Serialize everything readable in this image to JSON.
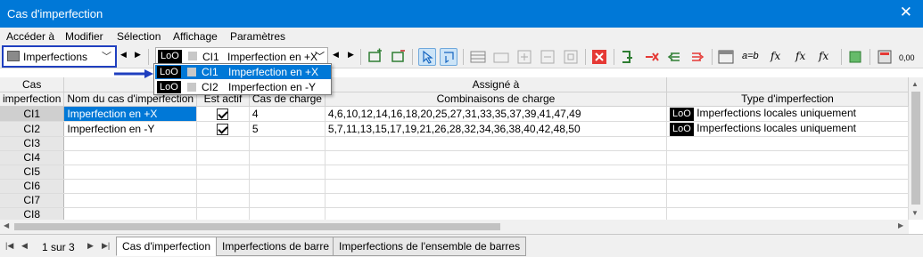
{
  "window": {
    "title": "Cas d'imperfection",
    "close_glyph": "✕"
  },
  "menu": [
    "Accéder à",
    "Modifier",
    "Sélection",
    "Affichage",
    "Paramètres"
  ],
  "toolbar": {
    "category_select": "Imperfections",
    "case_badge": "LoO",
    "case_code": "CI1",
    "case_name": "Imperfection en +X",
    "icons": [
      "insert-row-icon",
      "delete-row-icon",
      "select-icon",
      "pick-icon",
      "table-layout-icon",
      "table-add-icon",
      "table-insert-icon",
      "table-delete-icon",
      "table-copy-icon",
      "delete-icon",
      "load-icon",
      "remove-load-icon",
      "arrow-left-icon",
      "arrow-right-icon",
      "column-icon",
      "formula-ab-icon",
      "fx-icon",
      "fx-edit-icon",
      "fx-star-icon",
      "export-icon",
      "calculator-icon",
      "number-format-icon"
    ]
  },
  "dropdown": {
    "items": [
      {
        "badge": "LoO",
        "code": "CI1",
        "name": "Imperfection en +X",
        "active": true
      },
      {
        "badge": "LoO",
        "code": "CI2",
        "name": "Imperfection en -Y",
        "active": false
      }
    ]
  },
  "table": {
    "col_headers_top": [
      "Cas",
      "",
      "",
      "",
      "Assigné à",
      ""
    ],
    "col_headers_bottom": [
      "imperfection",
      "Nom du cas d'imperfection",
      "Est actif",
      "Cas de charge",
      "Combinaisons de charge",
      "Type d'imperfection"
    ],
    "rows": [
      {
        "id": "CI1",
        "name": "Imperfection en +X",
        "active": true,
        "load_case": "4",
        "combinations": "4,6,10,12,14,16,18,20,25,27,31,33,35,37,39,41,47,49",
        "type_badge": "LoO",
        "type": "Imperfections locales uniquement"
      },
      {
        "id": "CI2",
        "name": "Imperfection en -Y",
        "active": true,
        "load_case": "5",
        "combinations": "5,7,11,13,15,17,19,21,26,28,32,34,36,38,40,42,48,50",
        "type_badge": "LoO",
        "type": "Imperfections locales uniquement"
      },
      {
        "id": "CI3"
      },
      {
        "id": "CI4"
      },
      {
        "id": "CI5"
      },
      {
        "id": "CI6"
      },
      {
        "id": "CI7"
      },
      {
        "id": "CI8"
      }
    ]
  },
  "pager": {
    "info": "1 sur 3"
  },
  "tabs": [
    "Cas d'imperfection",
    "Imperfections de barre",
    "Imperfections de l'ensemble de barres"
  ],
  "colors": {
    "accent": "#0078d7",
    "callout": "#1f3fbf"
  }
}
